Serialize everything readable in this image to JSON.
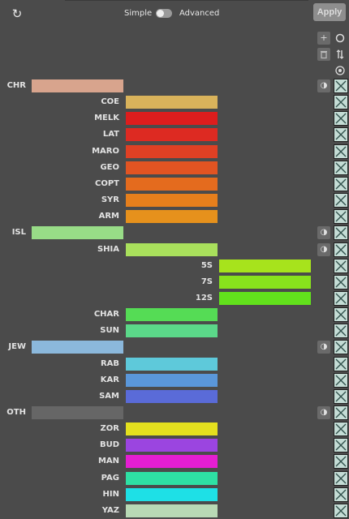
{
  "header": {
    "reset_icon": "reset-icon",
    "mode_left": "Simple",
    "mode_right": "Advanced",
    "apply_label": "Apply"
  },
  "tools": {
    "add_icon": "plus-icon",
    "radio_icon": "circle-icon",
    "delete_icon": "trash-icon",
    "sort_icon": "sort-icon",
    "target_icon": "target-icon"
  },
  "colors": {
    "background": "#4b4b4b",
    "checkbox": "#c4dcd5"
  },
  "rows": [
    {
      "label": "CHR",
      "level": 0,
      "color": "#d8a48d",
      "contrast": true
    },
    {
      "label": "COE",
      "level": 1,
      "color": "#d9b35b"
    },
    {
      "label": "MELK",
      "level": 1,
      "color": "#dd1d1d"
    },
    {
      "label": "LAT",
      "level": 1,
      "color": "#dd2a22"
    },
    {
      "label": "MARO",
      "level": 1,
      "color": "#e04024"
    },
    {
      "label": "GEO",
      "level": 1,
      "color": "#e25422"
    },
    {
      "label": "COPT",
      "level": 1,
      "color": "#e46b1e"
    },
    {
      "label": "SYR",
      "level": 1,
      "color": "#e67f1c"
    },
    {
      "label": "ARM",
      "level": 1,
      "color": "#e6911c"
    },
    {
      "label": "ISL",
      "level": 0,
      "color": "#98dc87",
      "contrast": true
    },
    {
      "label": "SHIA",
      "level": 1,
      "color": "#a9e05c",
      "contrast": true
    },
    {
      "label": "5S",
      "level": 2,
      "color": "#a7e31c"
    },
    {
      "label": "7S",
      "level": 2,
      "color": "#88e31c"
    },
    {
      "label": "12S",
      "level": 2,
      "color": "#62e11c"
    },
    {
      "label": "CHAR",
      "level": 1,
      "color": "#55dc55"
    },
    {
      "label": "SUN",
      "level": 1,
      "color": "#5bd889"
    },
    {
      "label": "JEW",
      "level": 0,
      "color": "#8bb8dc",
      "contrast": true
    },
    {
      "label": "RAB",
      "level": 1,
      "color": "#5ec9da"
    },
    {
      "label": "KAR",
      "level": 1,
      "color": "#5a97da"
    },
    {
      "label": "SAM",
      "level": 1,
      "color": "#5a6bd8"
    },
    {
      "label": "OTH",
      "level": 0,
      "color": "#666666",
      "contrast": true
    },
    {
      "label": "ZOR",
      "level": 1,
      "color": "#e4e01e"
    },
    {
      "label": "BUD",
      "level": 1,
      "color": "#9b45e0"
    },
    {
      "label": "MAN",
      "level": 1,
      "color": "#e41ed2"
    },
    {
      "label": "PAG",
      "level": 1,
      "color": "#2ee0a4"
    },
    {
      "label": "HIN",
      "level": 1,
      "color": "#1ee0e6"
    },
    {
      "label": "YAZ",
      "level": 1,
      "color": "#b8d9b5"
    }
  ]
}
